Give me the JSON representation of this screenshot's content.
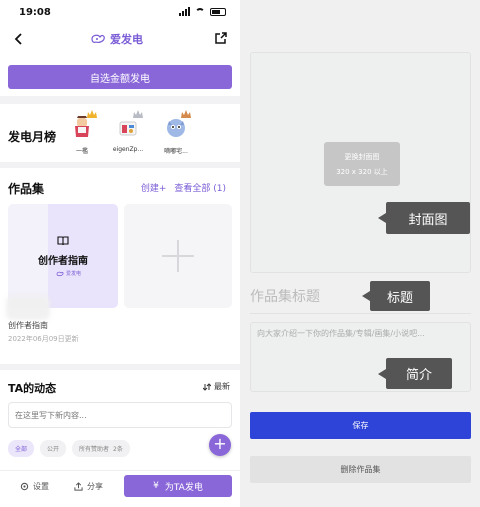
{
  "status_bar": {
    "time": "19:08"
  },
  "nav": {
    "title": "爱发电"
  },
  "fund": {
    "button_label": "自选金额发电"
  },
  "ranking": {
    "title": "发电月榜",
    "users": [
      {
        "name": "一檻"
      },
      {
        "name": "eigenZp..."
      },
      {
        "name": "嘀嘟宅..."
      }
    ]
  },
  "works": {
    "title": "作品集",
    "create_label": "创建+",
    "view_all_label": "查看全部",
    "count": "(1)",
    "guide": {
      "title": "创作者指南",
      "subtitle": "爱发电"
    },
    "item_name": "创作者指南",
    "item_date": "2022年06月09日更新"
  },
  "feed": {
    "title": "TA的动态",
    "sort_label": "最新",
    "input_placeholder": "在这里写下新内容...",
    "chips": [
      {
        "label": "全部"
      },
      {
        "label": "公开"
      },
      {
        "label": "所有赞助者",
        "count": "2条"
      }
    ],
    "fab_label": "+"
  },
  "bottom_bar": {
    "settings_label": "设置",
    "share_label": "分享",
    "support_label": "为TA发电",
    "support_currency": "¥"
  },
  "editor": {
    "cover_button": {
      "line1": "更换封面图",
      "line2": "320 x 320 以上"
    },
    "title_placeholder": "作品集标题",
    "description_placeholder": "向大家介绍一下你的作品集/专辑/画集/小说吧...",
    "save_label": "保存",
    "delete_label": "删除作品集"
  },
  "callouts": {
    "cover": "封面图",
    "title": "标题",
    "intro": "简介"
  },
  "colors": {
    "accent_purple": "#8a67d8",
    "save_blue": "#2e44d8",
    "callout_gray": "#555555"
  }
}
